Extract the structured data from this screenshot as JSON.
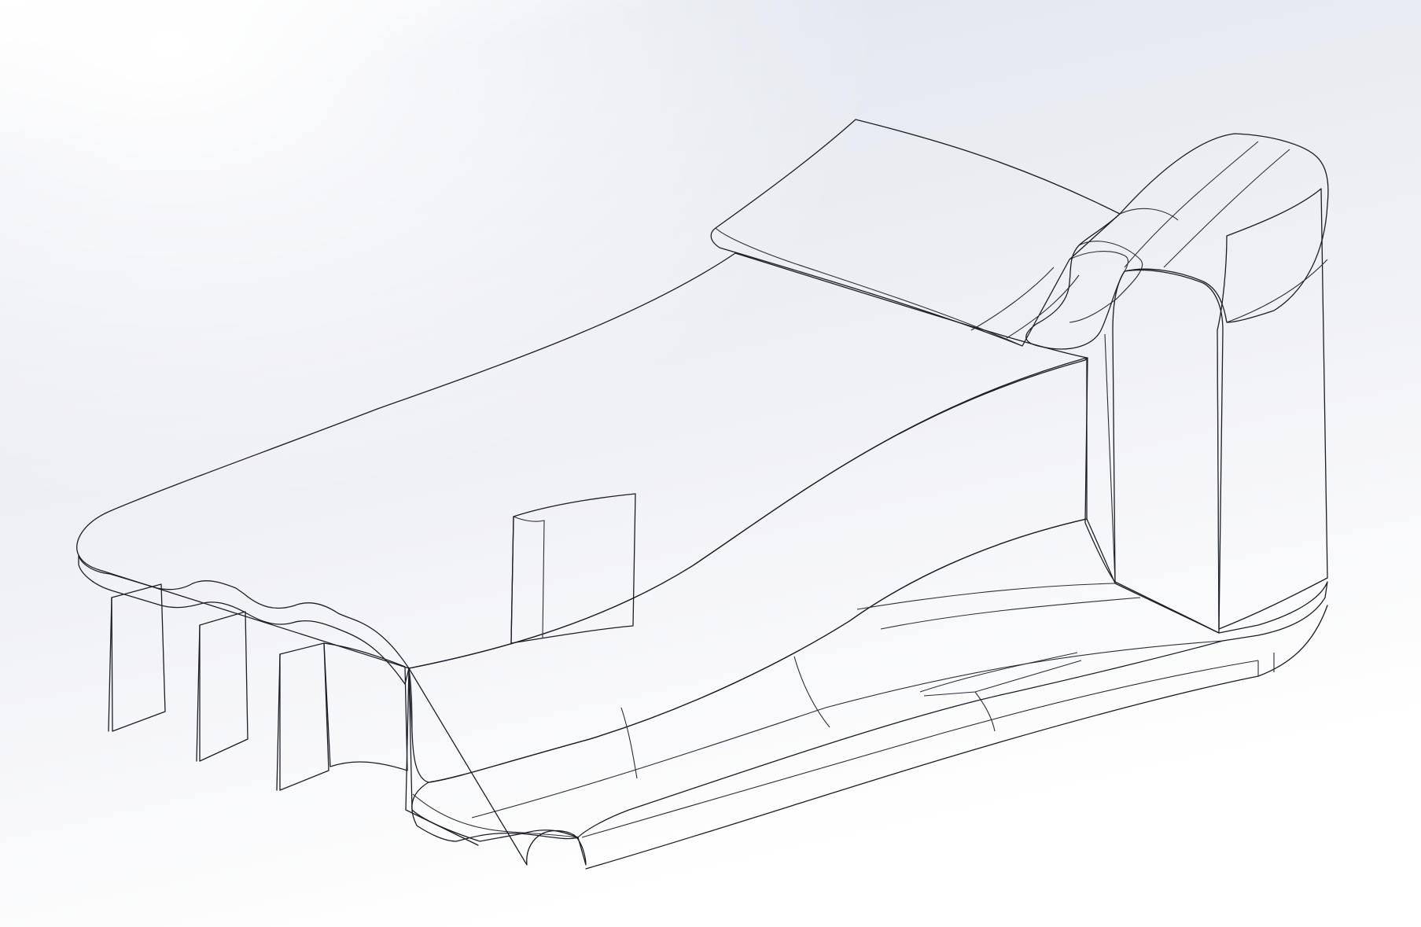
{
  "viewport": {
    "background_top_color": "#dde0ea",
    "background_bottom_color": "#ffffff"
  },
  "model": {
    "part": "front-wing-endplate-assembly",
    "colors": {
      "face_light": "#9aa0b2",
      "face_mid": "#8c91a3",
      "face_dark": "#777c8e",
      "face_darker": "#62667a",
      "edge": "#1b1d24"
    }
  }
}
